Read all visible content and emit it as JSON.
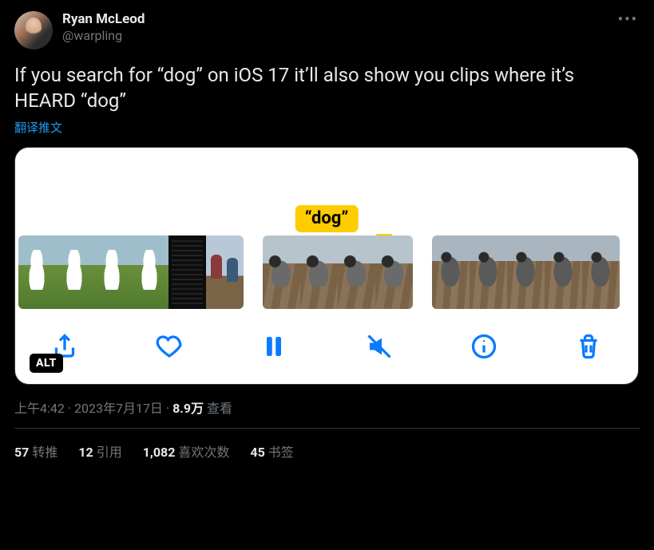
{
  "author": {
    "display_name": "Ryan McLeod",
    "handle": "@warpling"
  },
  "tweet_text": "If you search for “dog” on iOS 17 it’ll also show you clips where it’s HEARD “dog”",
  "translate_label": "翻译推文",
  "media": {
    "search_tag": "“dog”",
    "alt_badge": "ALT",
    "toolbar": {
      "share": "share-icon",
      "like": "heart-icon",
      "pause": "pause-icon",
      "mute": "speaker-muted-icon",
      "info": "info-icon",
      "trash": "trash-icon"
    }
  },
  "meta": {
    "time": "上午4:42",
    "sep1": " · ",
    "date": "2023年7月17日",
    "sep2": " · ",
    "views_count": "8.9万",
    "views_label": " 查看"
  },
  "stats": {
    "retweets_count": "57",
    "retweets_label": "转推",
    "quotes_count": "12",
    "quotes_label": "引用",
    "likes_count": "1,082",
    "likes_label": "喜欢次数",
    "bookmarks_count": "45",
    "bookmarks_label": "书签"
  }
}
